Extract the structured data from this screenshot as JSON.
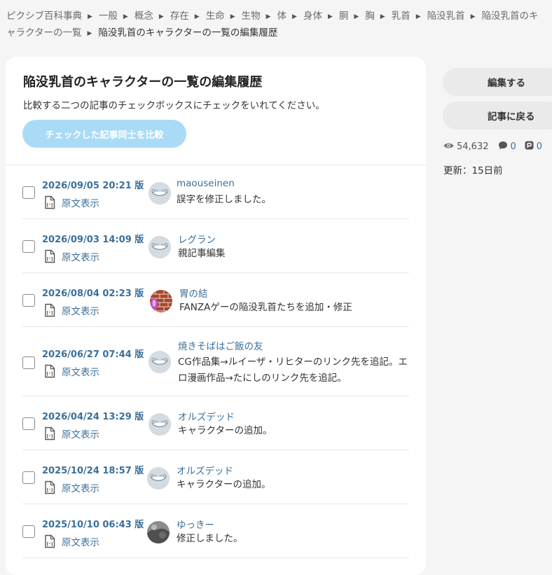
{
  "breadcrumb": {
    "items": [
      "ピクシブ百科事典",
      "一般",
      "概念",
      "存在",
      "生命",
      "生物",
      "体",
      "身体",
      "胴",
      "胸",
      "乳首",
      "陥没乳首",
      "陥没乳首のキャラクターの一覧"
    ],
    "current": "陥没乳首のキャラクターの一覧の編集履歴"
  },
  "main": {
    "title": "陥没乳首のキャラクターの一覧の編集履歴",
    "description": "比較する二つの記事のチェックボックスにチェックをいれてください。",
    "compare_button": "チェックした記事同士を比較",
    "source_label": "原文表示",
    "revisions": [
      {
        "date": "2026/09/05 20:21 版",
        "user": "maouseinen",
        "summary": "誤字を修正しました。",
        "avatar": "default"
      },
      {
        "date": "2026/09/03 14:09 版",
        "user": "レグラン",
        "summary": "親記事編集",
        "avatar": "default"
      },
      {
        "date": "2026/08/04 02:23 版",
        "user": "胃の結",
        "summary": "FANZAゲーの陥没乳首たちを追加・修正",
        "avatar": "brick"
      },
      {
        "date": "2026/06/27 07:44 版",
        "user": "焼きそばはご飯の友",
        "summary": "CG作品集→ルイーザ・リヒターのリンク先を追記。エロ漫画作品→たにしのリンク先を追記。",
        "avatar": "default"
      },
      {
        "date": "2026/04/24 13:29 版",
        "user": "オルズデッド",
        "summary": "キャラクターの追加。",
        "avatar": "default"
      },
      {
        "date": "2025/10/24 18:57 版",
        "user": "オルズデッド",
        "summary": "キャラクターの追加。",
        "avatar": "default"
      },
      {
        "date": "2025/10/10 06:43 版",
        "user": "ゆっきー",
        "summary": "修正しました。",
        "avatar": "photo"
      }
    ]
  },
  "sidebar": {
    "edit_button": "編集する",
    "back_button": "記事に戻る",
    "views": "54,632",
    "comments": "0",
    "pixiv": "0",
    "updated": "更新：15日前",
    "icons": [
      "eye-icon",
      "comment-icon",
      "pixiv-icon"
    ]
  },
  "colors": {
    "link": "#3a6f9a",
    "compare_button_bg": "#a9dbf7",
    "side_button_bg": "#eaeaea",
    "card_bg": "#ffffff",
    "page_bg": "#f5f5f5"
  }
}
